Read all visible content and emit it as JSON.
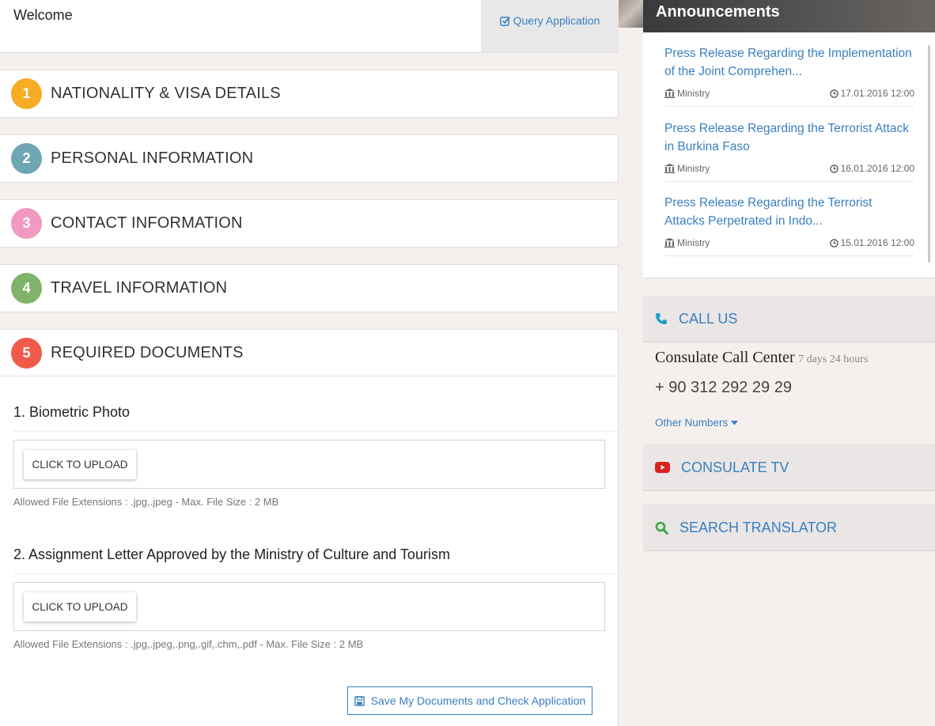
{
  "welcome": {
    "text": "Welcome",
    "query_label": "Query Application"
  },
  "steps": [
    {
      "num": "1",
      "title": "NATIONALITY & VISA DETAILS",
      "color": "#f6ac24"
    },
    {
      "num": "2",
      "title": "PERSONAL INFORMATION",
      "color": "#6ea7b3"
    },
    {
      "num": "3",
      "title": "CONTACT INFORMATION",
      "color": "#f199c0"
    },
    {
      "num": "4",
      "title": "TRAVEL INFORMATION",
      "color": "#7fb36a"
    },
    {
      "num": "5",
      "title": "REQUIRED DOCUMENTS",
      "color": "#ef5a4a"
    }
  ],
  "documents": [
    {
      "title": "1. Biometric Photo",
      "upload_label": "CLICK TO UPLOAD",
      "allowed": "Allowed File Extensions : .jpg,.jpeg - Max. File Size : 2 MB"
    },
    {
      "title": "2. Assignment Letter Approved by the Ministry of Culture and Tourism",
      "upload_label": "CLICK TO UPLOAD",
      "allowed": "Allowed File Extensions : .jpg,.jpeg,.png,.gif,.chm,.pdf - Max. File Size : 2 MB"
    }
  ],
  "save_label": "Save My Documents and Check Application",
  "announcements": {
    "header": "Announcements",
    "items": [
      {
        "title": "Press Release Regarding the Implementation of the Joint Comprehen...",
        "source": "Ministry",
        "date": "17.01.2016 12:00"
      },
      {
        "title": "Press Release Regarding the Terrorist Attack in Burkina Faso",
        "source": "Ministry",
        "date": "16.01.2016 12:00"
      },
      {
        "title": "Press Release Regarding the Terrorist Attacks Perpetrated in Indo...",
        "source": "Ministry",
        "date": "15.01.2016 12:00"
      }
    ]
  },
  "call_us": {
    "label": "CALL US",
    "center": "Consulate Call Center",
    "hours": "7 days 24 hours",
    "phone": "+ 90 312 292 29 29",
    "other_numbers": "Other Numbers"
  },
  "consulate_tv": {
    "label": "CONSULATE TV"
  },
  "search_translator": {
    "label": "SEARCH TRANSLATOR"
  },
  "colors": {
    "link": "#3a7fc1",
    "phone_icon": "#1a9fc7",
    "tv_icon": "#d9231d",
    "search_icon": "#3aa843"
  }
}
